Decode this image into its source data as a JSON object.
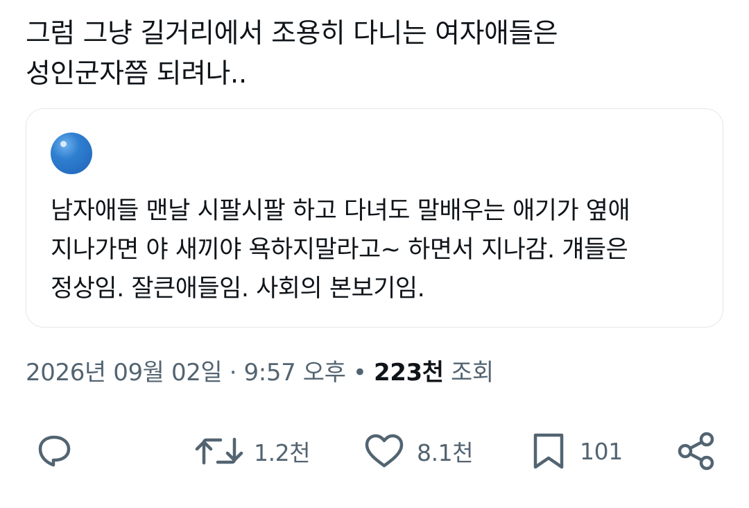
{
  "tweet": {
    "text": "그럼 그냥 길거리에서 조용히 다니는 여자애들은\n성인군자쯤 되려나.."
  },
  "quote": {
    "text": "남자애들 맨날 시팔시팔 하고 다녀도 말배우는 애기가 옆애\n지나가면 야 새끼야 욕하지말라고~ 하면서 지나감. 걔들은\n정상임. 잘큰애들임. 사회의 본보기임."
  },
  "meta": {
    "date": "2026년 09월 02일",
    "separator1": " · ",
    "time": "9:57 오후",
    "separator2": " • ",
    "views_count": "223천",
    "views_label": " 조회"
  },
  "actions": {
    "reply_icon": "reply-icon",
    "retweet_icon": "retweet-icon",
    "retweet_count": "1.2천",
    "like_icon": "heart-icon",
    "like_count": "8.1천",
    "bookmark_icon": "bookmark-icon",
    "bookmark_count": "101",
    "share_icon": "share-icon"
  },
  "colors": {
    "text": "#0f1419",
    "secondary": "#536471",
    "border": "#e3e6e9",
    "avatar": "#2f7fd1"
  }
}
